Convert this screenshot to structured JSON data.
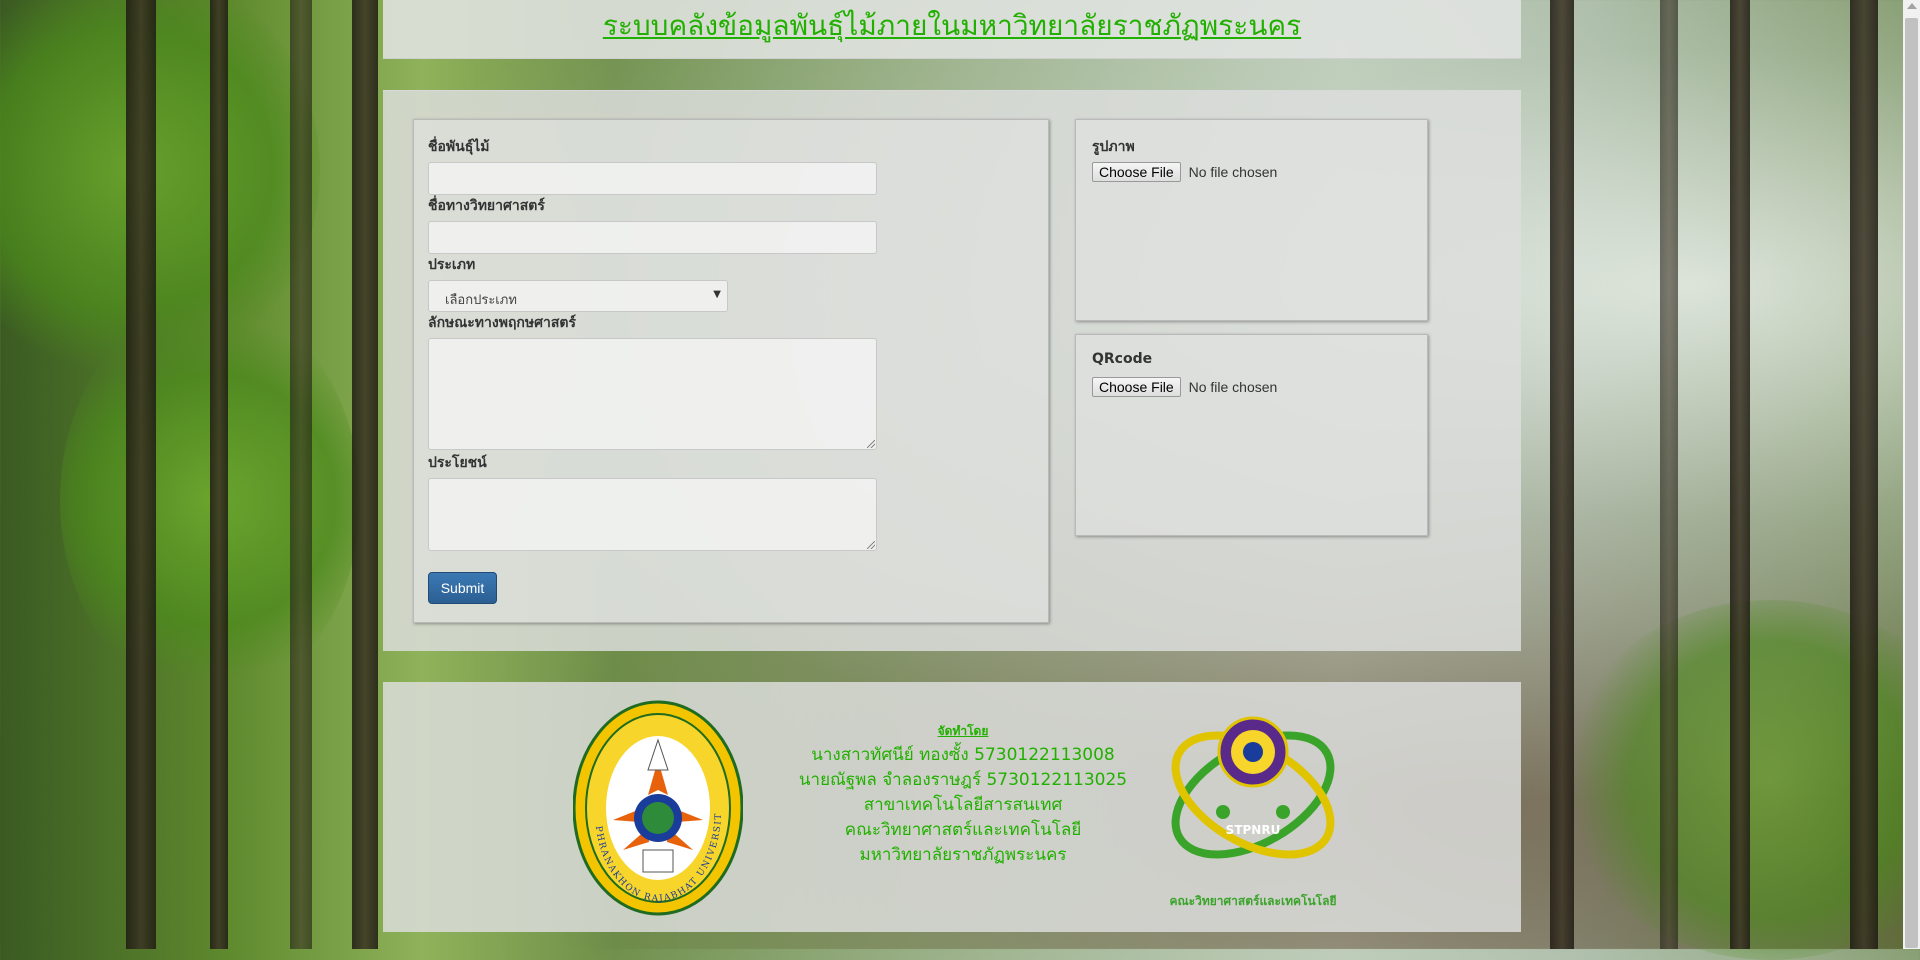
{
  "header": {
    "title": "ระบบคลังข้อมูลพันธุ์ไม้ภายในมหาวิทยาลัยราชภัฏพระนคร"
  },
  "form": {
    "plant_name_label": "ชื่อพันธุ์ไม้",
    "plant_name_value": "",
    "scientific_name_label": "ชื่อทางวิทยาศาสตร์",
    "scientific_name_value": "",
    "type_label": "ประเภท",
    "type_selected": "เลือกประเภท",
    "botany_label": "ลักษณะทางพฤกษศาสตร์",
    "botany_value": "",
    "benefit_label": "ประโยชน์",
    "benefit_value": "",
    "submit_label": "Submit"
  },
  "uploads": {
    "image_label": "รูปภาพ",
    "qrcode_label": "QRcode",
    "choose_file_label": "Choose File",
    "no_file_text": "No file chosen"
  },
  "footer": {
    "heading": "จัดทำโดย",
    "lines": [
      "นางสาวทัศนีย์ ทองซั้ง 5730122113008",
      "นายณัฐพล จำลองราษฎร์ 5730122113025",
      "สาขาเทคโนโลยีสารสนเทศ",
      "คณะวิทยาศาสตร์และเทคโนโลยี",
      "มหาวิทยาลัยราชภัฏพระนคร"
    ],
    "left_logo_text": "PHRANAKHON RAJABHAT UNIVERSITY",
    "right_logo_badge": "STPNRU",
    "right_logo_caption": "คณะวิทยาศาสตร์และเทคโนโลยี"
  },
  "colors": {
    "title_green": "#22b000",
    "submit_blue": "#2b5f93",
    "panel_gray": "#dcdedc"
  }
}
